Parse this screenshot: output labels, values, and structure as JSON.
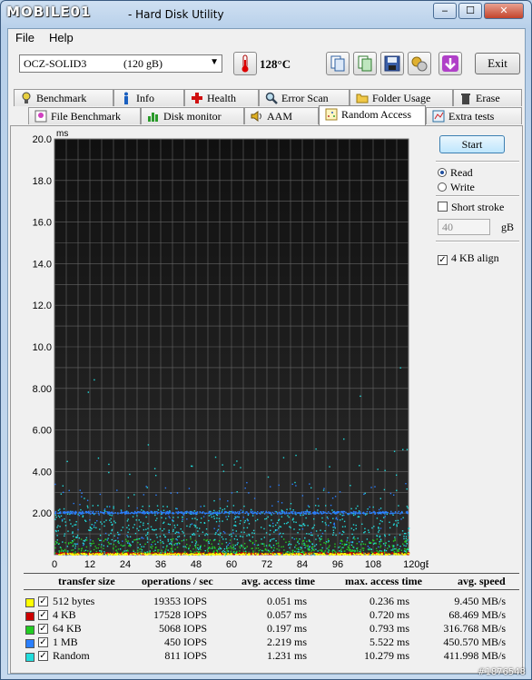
{
  "window": {
    "logo_text": "MOBILE01",
    "title": "- Hard Disk Utility",
    "minimize": "‒",
    "maximize": "☐",
    "close": "✕"
  },
  "menu": [
    {
      "label": "File"
    },
    {
      "label": "Help"
    }
  ],
  "toolbar": {
    "drive_name": "OCZ-SOLID3",
    "drive_size": "(120 gB)",
    "temperature": "128°C",
    "exit_label": "Exit"
  },
  "tabs_top": [
    "Benchmark",
    "Info",
    "Health",
    "Error Scan",
    "Folder Usage",
    "Erase"
  ],
  "tabs_bottom": [
    "File Benchmark",
    "Disk monitor",
    "AAM",
    "Random Access",
    "Extra tests"
  ],
  "controls": {
    "start_label": "Start",
    "read_label": "Read",
    "write_label": "Write",
    "short_stroke_label": "Short stroke",
    "stroke_value": "40",
    "stroke_unit": "gB",
    "align_label": "4 KB align"
  },
  "chart_data": {
    "type": "scatter",
    "ylabel": "ms",
    "xlabel": "gB",
    "ylim": [
      0,
      20
    ],
    "xlim": [
      0,
      120
    ],
    "y_ticks": [
      "2.00",
      "4.00",
      "6.00",
      "8.00",
      "10.0",
      "12.0",
      "14.0",
      "16.0",
      "18.0",
      "20.0"
    ],
    "x_ticks": [
      "0",
      "12",
      "24",
      "36",
      "48",
      "60",
      "72",
      "84",
      "96",
      "108",
      "120gB"
    ],
    "background": "#2a2a2a",
    "grid": true,
    "series": [
      {
        "name": "512 bytes",
        "color": "#ffff00",
        "avg_ms": 0.051
      },
      {
        "name": "4 KB",
        "color": "#cc0000",
        "avg_ms": 0.057
      },
      {
        "name": "64 KB",
        "color": "#22cc22",
        "avg_ms": 0.197
      },
      {
        "name": "1 MB",
        "color": "#2a7fff",
        "avg_ms": 2.219
      },
      {
        "name": "Random",
        "color": "#22dddd",
        "avg_ms": 1.231
      }
    ]
  },
  "results": {
    "headers": [
      "transfer size",
      "operations / sec",
      "avg. access time",
      "max. access time",
      "avg. speed"
    ],
    "rows": [
      {
        "size": "512 bytes",
        "color": "#ffff00",
        "ops": "19353 IOPS",
        "avg": "0.051 ms",
        "max": "0.236 ms",
        "speed": "9.450 MB/s"
      },
      {
        "size": "4 KB",
        "color": "#cc0000",
        "ops": "17528 IOPS",
        "avg": "0.057 ms",
        "max": "0.720 ms",
        "speed": "68.469 MB/s"
      },
      {
        "size": "64 KB",
        "color": "#22cc22",
        "ops": "5068 IOPS",
        "avg": "0.197 ms",
        "max": "0.793 ms",
        "speed": "316.768 MB/s"
      },
      {
        "size": "1 MB",
        "color": "#2a7fff",
        "ops": "450 IOPS",
        "avg": "2.219 ms",
        "max": "5.522 ms",
        "speed": "450.570 MB/s"
      },
      {
        "size": "Random",
        "color": "#22dddd",
        "ops": "811 IOPS",
        "avg": "1.231 ms",
        "max": "10.279 ms",
        "speed": "411.998 MB/s"
      }
    ]
  },
  "watermark": "#1876548"
}
